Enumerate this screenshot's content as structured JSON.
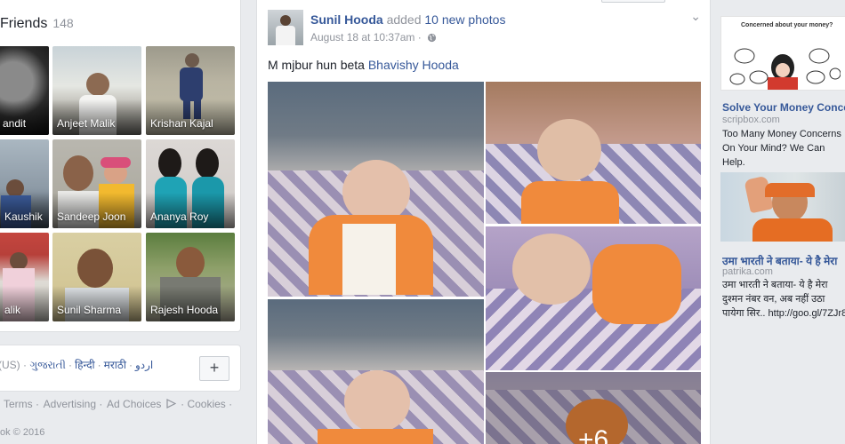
{
  "friends": {
    "title": "Friends",
    "count": "148",
    "tiles": [
      {
        "name": "andit"
      },
      {
        "name": "Anjeet Malik"
      },
      {
        "name": "Krishan Kajal"
      },
      {
        "name": "Kaushik"
      },
      {
        "name": "Sandeep Joon"
      },
      {
        "name": "Ananya Roy"
      },
      {
        "name": "alik"
      },
      {
        "name": "Sunil Sharma"
      },
      {
        "name": "Rajesh Hooda"
      }
    ]
  },
  "languages": {
    "first": "(US) ·",
    "items": [
      "ગુજરાતી",
      "हिन्दी",
      "मराठी",
      "اردو"
    ],
    "add_label": "+"
  },
  "footer": {
    "links": [
      "Terms ·",
      "Advertising ·",
      "Ad Choices",
      "· Cookies ·"
    ],
    "copyright": "ok © 2016"
  },
  "post": {
    "author": "Sunil Hooda",
    "action": "added",
    "photos_link": "10 new photos",
    "timestamp": "August 18 at 10:37am ·",
    "text": "M mjbur hun beta",
    "mention": "Bhavishy Hooda",
    "more_count": "+6"
  },
  "ads": [
    {
      "image_caption": "Concerned about your money?",
      "title": "Solve Your Money Conce…",
      "domain": "scripbox.com",
      "body": "Too Many Money Concerns On Your Mind? We Can Help."
    },
    {
      "title": "उमा भारती ने बताया- ये है मेरा",
      "domain": "patrika.com",
      "body": "उमा भारती ने बताया- ये है मेरा दुश्मन नंबर वन, अब नहीं उठा पायेगा सिर.. http://goo.gl/7ZJr8"
    }
  ],
  "colors": {
    "link": "#365899",
    "muted": "#90949c",
    "page_bg": "#e9ebee"
  }
}
